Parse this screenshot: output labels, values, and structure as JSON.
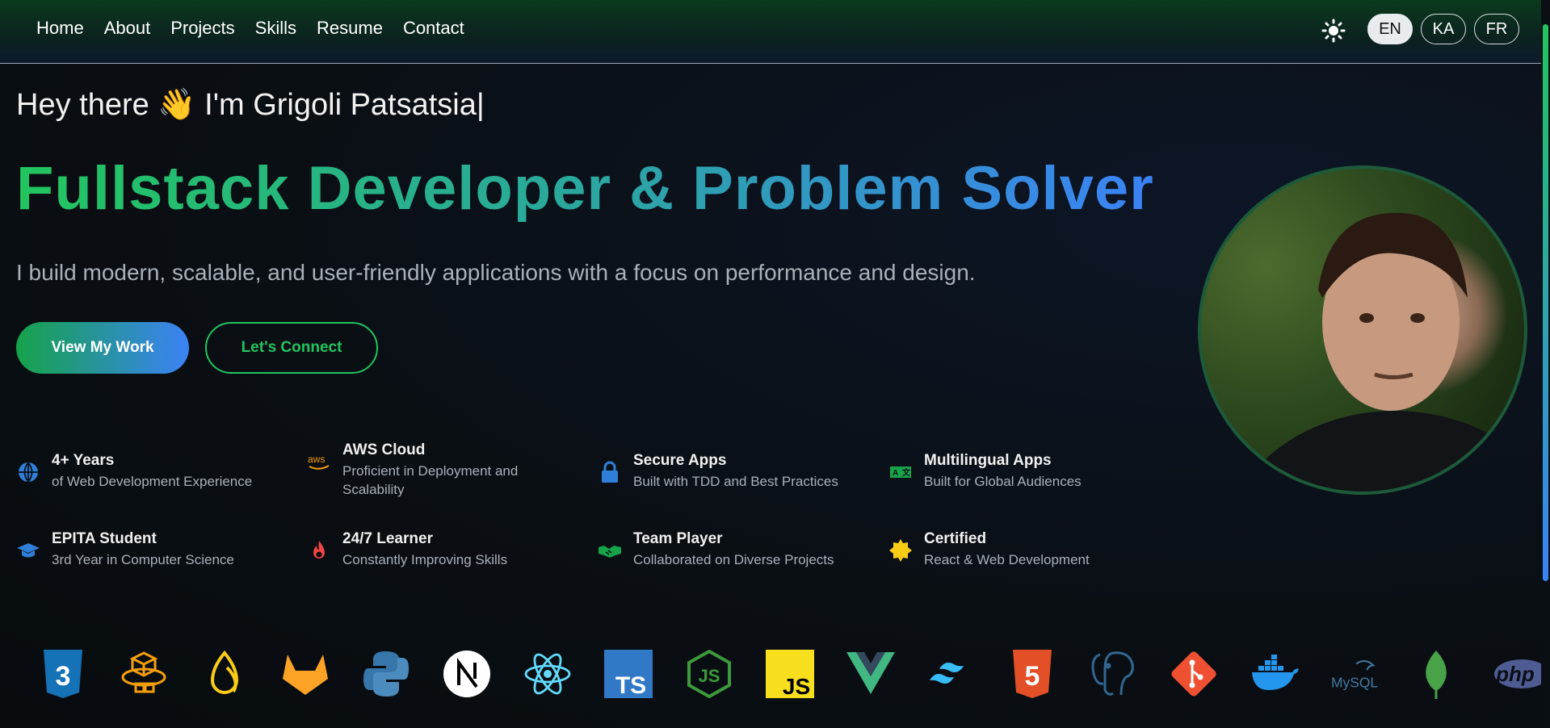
{
  "nav": {
    "links": [
      "Home",
      "About",
      "Projects",
      "Skills",
      "Resume",
      "Contact"
    ],
    "languages": [
      "EN",
      "KA",
      "FR"
    ],
    "active_language": "EN"
  },
  "hero": {
    "greeting": "Hey there 👋 I'm Grigoli Patsatsia|",
    "headline": "Fullstack Developer & Problem Solver",
    "subtitle": "I build modern, scalable, and user-friendly applications with a focus on performance and design.",
    "primary_button": "View My Work",
    "secondary_button": "Let's Connect"
  },
  "features": [
    {
      "title": "4+ Years",
      "desc": "of Web Development Experience",
      "icon": "globe-icon"
    },
    {
      "title": "AWS Cloud",
      "desc": "Proficient in Deployment and Scalability",
      "icon": "aws-icon"
    },
    {
      "title": "Secure Apps",
      "desc": "Built with TDD and Best Practices",
      "icon": "lock-icon"
    },
    {
      "title": "Multilingual Apps",
      "desc": "Built for Global Audiences",
      "icon": "translate-icon"
    },
    {
      "title": "EPITA Student",
      "desc": "3rd Year in Computer Science",
      "icon": "graduation-cap-icon"
    },
    {
      "title": "24/7 Learner",
      "desc": "Constantly Improving Skills",
      "icon": "fire-icon"
    },
    {
      "title": "Team Player",
      "desc": "Collaborated on Diverse Projects",
      "icon": "handshake-icon"
    },
    {
      "title": "Certified",
      "desc": "React & Web Development",
      "icon": "certificate-icon"
    }
  ],
  "tech_stack": [
    "css3-icon",
    "aws-amplify-icon",
    "supabase-icon",
    "gitlab-icon",
    "python-icon",
    "nextjs-icon",
    "react-icon",
    "typescript-icon",
    "nodejs-icon",
    "javascript-icon",
    "vue-icon",
    "tailwind-icon",
    "html5-icon",
    "postgresql-icon",
    "git-icon",
    "docker-icon",
    "mysql-icon",
    "mongodb-icon",
    "php-icon"
  ],
  "tech_labels": {
    "ts": "TS",
    "js": "JS",
    "mysql": "MySQL",
    "php": "php",
    "n": "N"
  },
  "colors": {
    "accent_green": "#22c55e",
    "accent_blue": "#3b82f6"
  }
}
